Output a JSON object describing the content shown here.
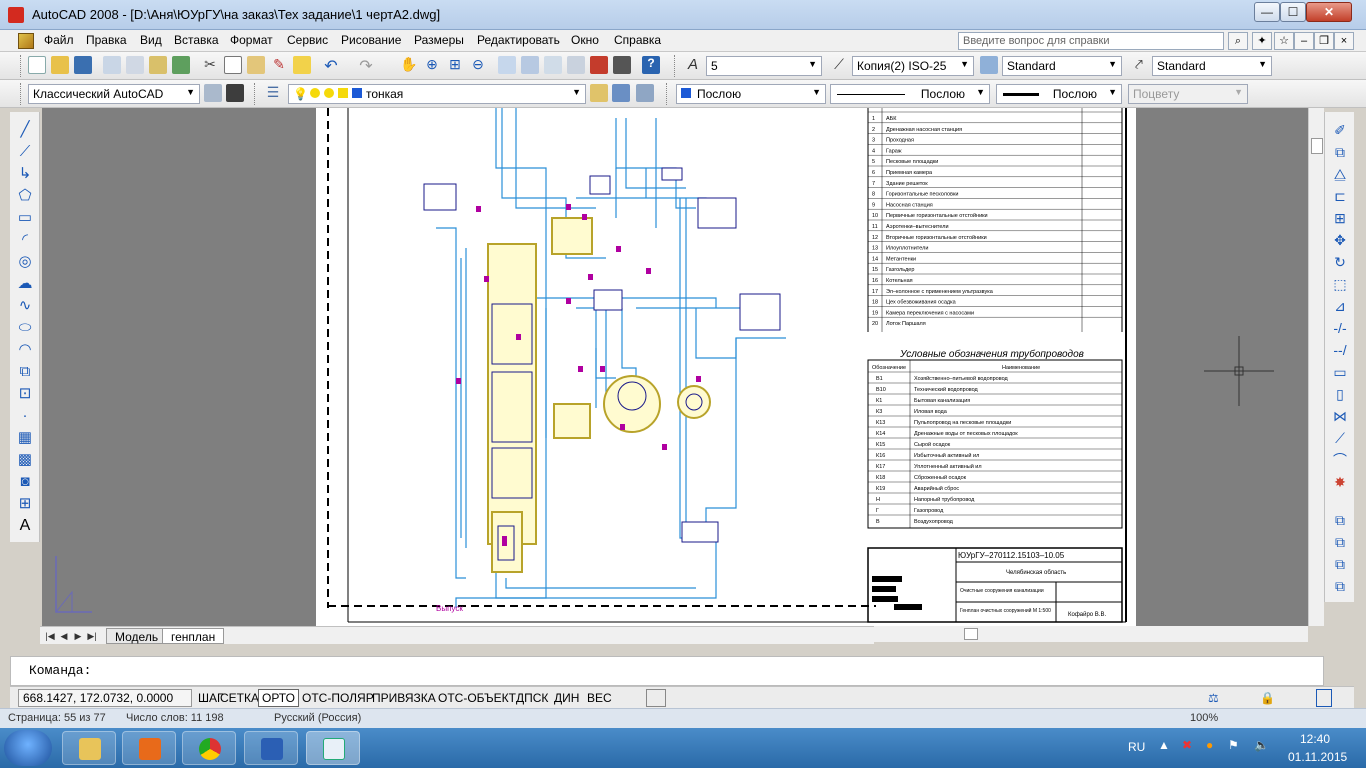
{
  "window": {
    "title": "AutoCAD 2008 - [D:\\Аня\\ЮУрГУ\\на заказ\\Тех задание\\1 чертА2.dwg]"
  },
  "menu": {
    "items": [
      "Файл",
      "Правка",
      "Вид",
      "Вставка",
      "Формат",
      "Сервис",
      "Рисование",
      "Размеры",
      "Редактировать",
      "Окно",
      "Справка"
    ],
    "help_placeholder": "Введите вопрос для справки"
  },
  "toolbar1": {
    "text_height": "5",
    "dim_style": "Копия(2) ISO-25",
    "table_style": "Standard",
    "multileader_style": "Standard"
  },
  "toolbar2": {
    "workspace": "Классический AutoCAD",
    "layer": "тонкая",
    "color": "Послою",
    "linetype": "Послою",
    "lineweight": "Послою",
    "plotstyle": "Поцвету"
  },
  "layout_tabs": [
    "Модель",
    "генплан"
  ],
  "command": {
    "prompt": "Команда:"
  },
  "status": {
    "coords": "668.1427, 172.0732, 0.0000",
    "buttons": [
      "ШАГ",
      "СЕТКА",
      "ОРТО",
      "ОТС-ПОЛЯР",
      "ПРИВЯЗКА",
      "ОТС-ОБЪЕКТ",
      "ДПСК",
      "ДИН",
      "ВЕС"
    ],
    "active": "ОРТО"
  },
  "word_status": {
    "page": "Страница: 55 из 77",
    "words": "Число слов: 11 198",
    "language": "Русский (Россия)",
    "zoom": "100%"
  },
  "taskbar": {
    "lang": "RU",
    "time": "12:40",
    "date": "01.11.2015"
  },
  "drawing": {
    "legend_title": "Условные обозначения трубопроводов",
    "stamp_code": "ЮУрГУ–270112.15103–10.05",
    "stamp_place": "Челябинская область",
    "stamp_object": "Очистные сооружения канализации",
    "stamp_sheet": "Генплан очистных сооружений М 1:500",
    "stamp_author": "Кофайро В.В.",
    "outlet_label": "Выпуск",
    "buildings": [
      {
        "n": "1",
        "name": "АБК"
      },
      {
        "n": "2",
        "name": "Дренажная насосная станция"
      },
      {
        "n": "3",
        "name": "Проходная"
      },
      {
        "n": "4",
        "name": "Гараж"
      },
      {
        "n": "5",
        "name": "Песковые площадки"
      },
      {
        "n": "6",
        "name": "Приемная камера"
      },
      {
        "n": "7",
        "name": "Здание решеток"
      },
      {
        "n": "8",
        "name": "Горизонтальные песколовки"
      },
      {
        "n": "9",
        "name": "Насосная станция"
      },
      {
        "n": "10",
        "name": "Первичные горизонтальные отстойники"
      },
      {
        "n": "11",
        "name": "Аэротенки–вытеснители"
      },
      {
        "n": "12",
        "name": "Вторичные горизонтальные отстойники"
      },
      {
        "n": "13",
        "name": "Илоуплотнители"
      },
      {
        "n": "14",
        "name": "Метантенки"
      },
      {
        "n": "15",
        "name": "Газгольдер"
      },
      {
        "n": "16",
        "name": "Котельная"
      },
      {
        "n": "17",
        "name": "Эл–колонное с применением ультразвука"
      },
      {
        "n": "18",
        "name": "Цех обезвоживания осадка"
      },
      {
        "n": "19",
        "name": "Камера переключения с насосами"
      },
      {
        "n": "20",
        "name": "Лоток Паршаля"
      }
    ],
    "pipes": [
      {
        "code": "В1",
        "name": "Хозяйственно–питьевой водопровод"
      },
      {
        "code": "В10",
        "name": "Технический водопровод"
      },
      {
        "code": "К1",
        "name": "Бытовая канализация"
      },
      {
        "code": "К3",
        "name": "Иловая вода"
      },
      {
        "code": "К13",
        "name": "Пульпопровод на песковые площадки"
      },
      {
        "code": "К14",
        "name": "Дренажные воды от песковых площадок"
      },
      {
        "code": "К15",
        "name": "Сырой осадок"
      },
      {
        "code": "К16",
        "name": "Избыточный активный ил"
      },
      {
        "code": "К17",
        "name": "Уплотненный активный ил"
      },
      {
        "code": "К18",
        "name": "Сброженный осадок"
      },
      {
        "code": "К19",
        "name": "Аварийный сброс"
      },
      {
        "code": "Н",
        "name": "Напорный трубопровод"
      },
      {
        "code": "Г",
        "name": "Газопровод"
      },
      {
        "code": "В",
        "name": "Воздухопровод"
      }
    ],
    "legend_headers": [
      "Обозначение",
      "Наименование"
    ]
  }
}
